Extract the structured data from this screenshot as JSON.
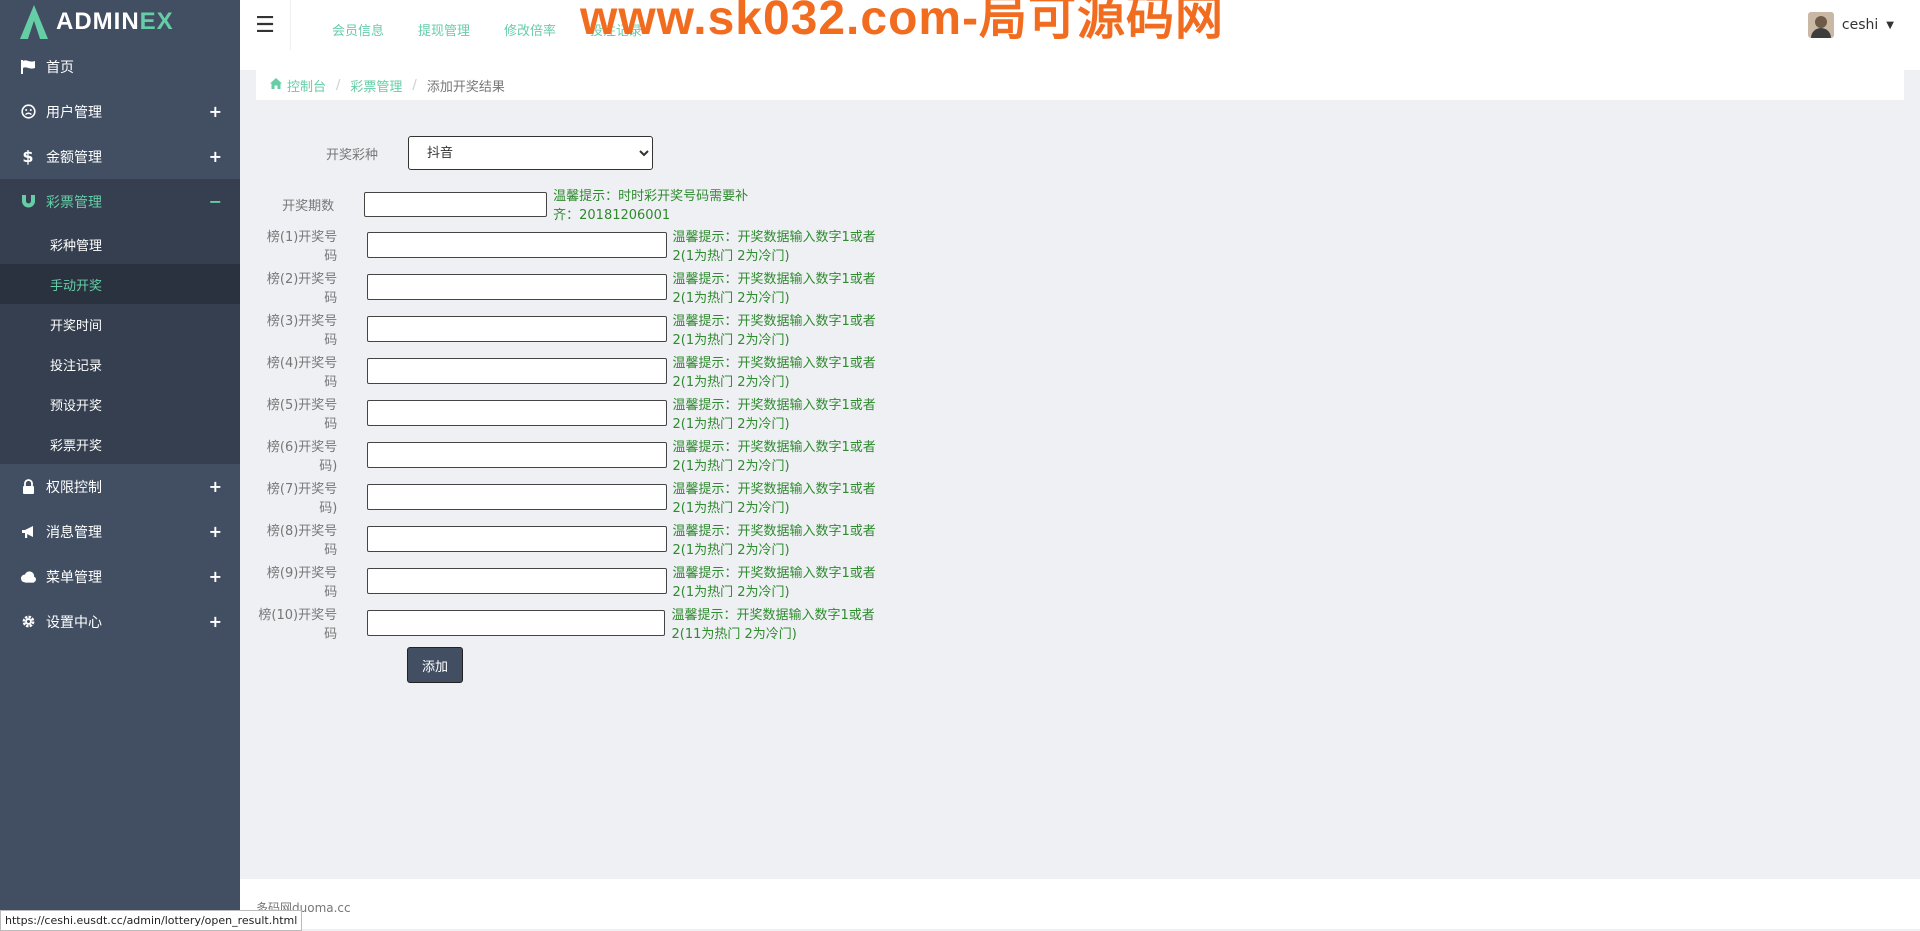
{
  "brand": {
    "part1": "ADMIN",
    "part2": "EX"
  },
  "sidebar": {
    "items": [
      {
        "label": "首页",
        "icon": "flag-icon",
        "toggle": ""
      },
      {
        "label": "用户管理",
        "icon": "smile-icon",
        "toggle": "+"
      },
      {
        "label": "金额管理",
        "icon": "dollar-icon",
        "toggle": "+"
      },
      {
        "label": "彩票管理",
        "icon": "magnet-icon",
        "toggle": "−"
      },
      {
        "label": "权限控制",
        "icon": "lock-icon",
        "toggle": "+"
      },
      {
        "label": "消息管理",
        "icon": "bullhorn-icon",
        "toggle": "+"
      },
      {
        "label": "菜单管理",
        "icon": "cloud-icon",
        "toggle": "+"
      },
      {
        "label": "设置中心",
        "icon": "gear-icon",
        "toggle": "+"
      }
    ],
    "subitems": [
      {
        "label": "彩种管理"
      },
      {
        "label": "手动开奖"
      },
      {
        "label": "开奖时间"
      },
      {
        "label": "投注记录"
      },
      {
        "label": "预设开奖"
      },
      {
        "label": "彩票开奖"
      }
    ]
  },
  "header": {
    "nav": [
      "会员信息",
      "提现管理",
      "修改倍率",
      "投注记录"
    ],
    "watermark": "www.sk032.com-局可源码网",
    "user_name": "ceshi"
  },
  "breadcrumb": {
    "home": "控制台",
    "section": "彩票管理",
    "current": "添加开奖结果"
  },
  "form": {
    "type_label": "开奖彩种",
    "type_selected": "抖音",
    "period_label": "开奖期数",
    "period_hint": "温馨提示：时时彩开奖号码需要补齐：20181206001",
    "rows": [
      {
        "label": "榜(1)开奖号码",
        "hint": "温馨提示：开奖数据输入数字1或者2(1为热门 2为冷门)"
      },
      {
        "label": "榜(2)开奖号码",
        "hint": "温馨提示：开奖数据输入数字1或者2(1为热门 2为冷门)"
      },
      {
        "label": "榜(3)开奖号码",
        "hint": "温馨提示：开奖数据输入数字1或者2(1为热门 2为冷门)"
      },
      {
        "label": "榜(4)开奖号码",
        "hint": "温馨提示：开奖数据输入数字1或者2(1为热门 2为冷门)"
      },
      {
        "label": "榜(5)开奖号码",
        "hint": "温馨提示：开奖数据输入数字1或者2(1为热门 2为冷门)"
      },
      {
        "label": "榜(6)开奖号码)",
        "hint": "温馨提示：开奖数据输入数字1或者2(1为热门 2为冷门)"
      },
      {
        "label": "榜(7)开奖号码)",
        "hint": "温馨提示：开奖数据输入数字1或者2(1为热门 2为冷门)"
      },
      {
        "label": "榜(8)开奖号码",
        "hint": "温馨提示：开奖数据输入数字1或者2(1为热门 2为冷门)"
      },
      {
        "label": "榜(9)开奖号码",
        "hint": "温馨提示：开奖数据输入数字1或者2(1为热门 2为冷门)"
      },
      {
        "label": "榜(10)开奖号码",
        "hint": "温馨提示：开奖数据输入数字1或者2(11为热门 2为冷门)"
      }
    ],
    "submit_label": "添加"
  },
  "footer": {
    "text": "多码网duoma.cc"
  },
  "status_url": "https://ceshi.eusdt.cc/admin/lottery/open_result.html",
  "colors": {
    "accent": "#65cea7",
    "sidebar": "#424f63",
    "hint": "#2e8b2e",
    "watermark": "#f26c1f"
  }
}
